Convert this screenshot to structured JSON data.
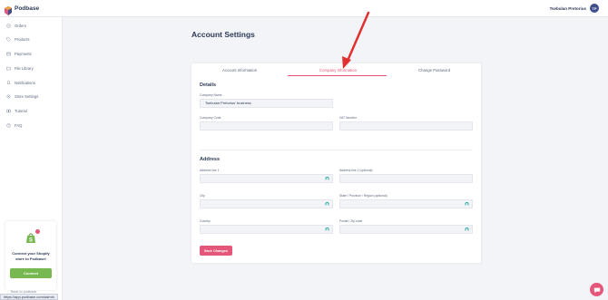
{
  "brand": {
    "name": "Podbase"
  },
  "user": {
    "name": "Tsebulan Pretorius",
    "initials": "TP"
  },
  "sidebar": {
    "items": [
      {
        "label": "Orders",
        "icon": "orders-icon"
      },
      {
        "label": "Products",
        "icon": "tag-icon"
      },
      {
        "label": "Payments",
        "icon": "card-icon"
      },
      {
        "label": "File Library",
        "icon": "folder-icon"
      },
      {
        "label": "Notifications",
        "icon": "bell-icon"
      },
      {
        "label": "Store Settings",
        "icon": "gear-icon"
      },
      {
        "label": "Tutorial",
        "icon": "book-icon"
      },
      {
        "label": "FAQ",
        "icon": "question-icon"
      }
    ]
  },
  "promo": {
    "line1": "Connect your Shopify",
    "line2": "store to Podbase!",
    "button": "Connect"
  },
  "back_link": "Back to podbase",
  "status_url": "https://app.podbase.com/admin",
  "page": {
    "title": "Account Settings"
  },
  "tabs": [
    {
      "label": "Account Information"
    },
    {
      "label": "Company Information"
    },
    {
      "label": "Change Password"
    }
  ],
  "details": {
    "title": "Details",
    "company_name": {
      "label": "Company Name",
      "value": "Tsebulan Pretorius' business"
    },
    "company_code": {
      "label": "Company Code",
      "value": ""
    },
    "vat_number": {
      "label": "VAT Number",
      "value": ""
    }
  },
  "address": {
    "title": "Address",
    "line1": {
      "label": "Address line 1",
      "value": ""
    },
    "line2": {
      "label": "Address line 2 (optional)",
      "value": ""
    },
    "city": {
      "label": "City",
      "value": ""
    },
    "state": {
      "label": "State / Province / Region (optional)",
      "value": ""
    },
    "country": {
      "label": "Country",
      "value": ""
    },
    "postal": {
      "label": "Postal / Zip code",
      "value": ""
    }
  },
  "save_button": "Save Changes",
  "colors": {
    "accent": "#e4567a",
    "connect": "#78b850",
    "text": "#2c3a57",
    "icon_teal": "#2aa9a0"
  }
}
